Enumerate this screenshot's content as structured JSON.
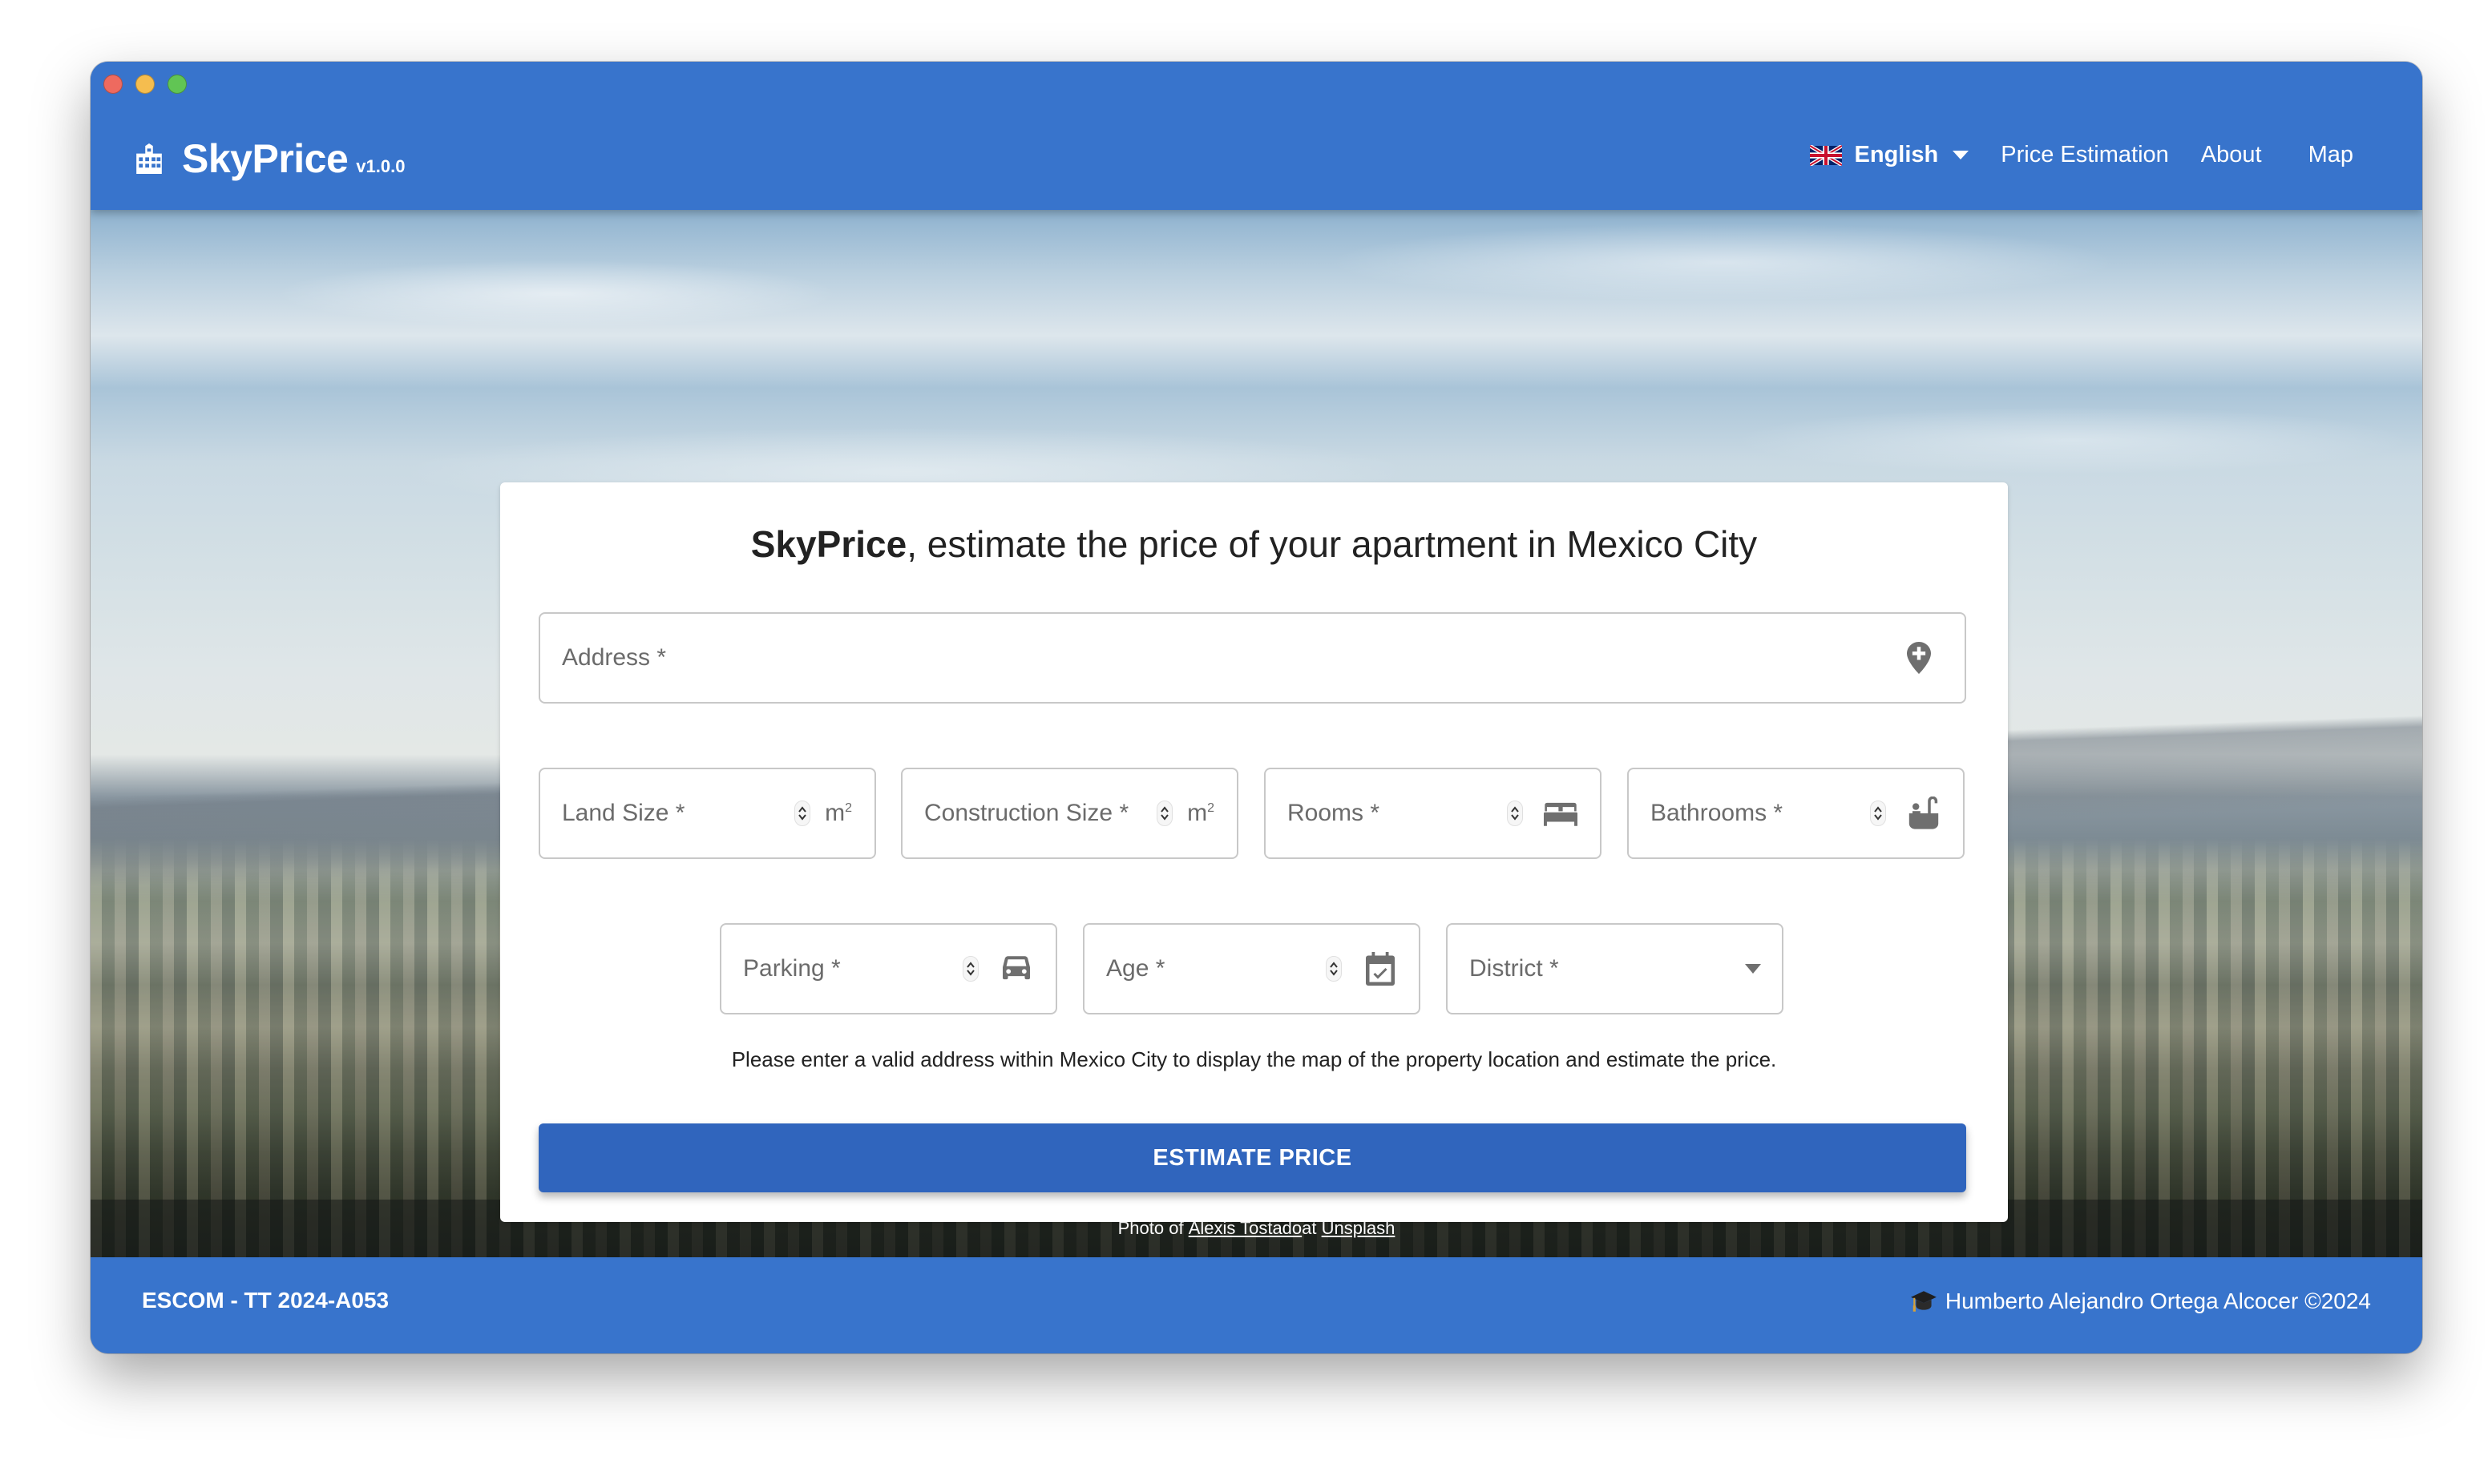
{
  "window": {
    "traffic_lights": [
      "close",
      "minimize",
      "maximize"
    ]
  },
  "header": {
    "brand": {
      "icon": "building-icon",
      "name": "SkyPrice",
      "version": "v1.0.0"
    },
    "language": {
      "flag": "uk-flag-icon",
      "label": "English",
      "icon": "caret-down-icon"
    },
    "nav": [
      {
        "label": "Price Estimation"
      },
      {
        "label": "About"
      },
      {
        "label": "Map"
      }
    ]
  },
  "card": {
    "title_bold": "SkyPrice",
    "title_rest": ", estimate the price of your apartment in Mexico City",
    "fields": {
      "address": {
        "label": "Address *",
        "value": "",
        "icon": "map-pin-plus-icon"
      },
      "land_size": {
        "label": "Land Size *",
        "value": "",
        "unit": "m",
        "unit_sup": "2"
      },
      "construction_size": {
        "label": "Construction Size *",
        "value": "",
        "unit": "m",
        "unit_sup": "2"
      },
      "rooms": {
        "label": "Rooms *",
        "value": "",
        "icon": "bed-icon"
      },
      "bathrooms": {
        "label": "Bathrooms *",
        "value": "",
        "icon": "bathtub-icon"
      },
      "parking": {
        "label": "Parking *",
        "value": "",
        "icon": "car-icon"
      },
      "age": {
        "label": "Age *",
        "value": "",
        "icon": "calendar-check-icon"
      },
      "district": {
        "label": "District *",
        "selected": "",
        "icon": "caret-down-icon"
      }
    },
    "hint": "Please enter a valid address within Mexico City to display the map of the property location and estimate the price.",
    "estimate_button": "ESTIMATE PRICE"
  },
  "photo_credit": {
    "prefix": "Photo of ",
    "author": "Alexis Tostado",
    "middle": " at ",
    "source": "Unsplash"
  },
  "footer": {
    "left": "ESCOM - TT 2024-A053",
    "right_icon": "graduation-cap-icon",
    "right": "Humberto Alejandro Ortega Alcocer ©2024"
  },
  "colors": {
    "primary": "#3874cc",
    "button": "#3065bd",
    "text": "#222222",
    "muted": "#6b6b6b"
  }
}
